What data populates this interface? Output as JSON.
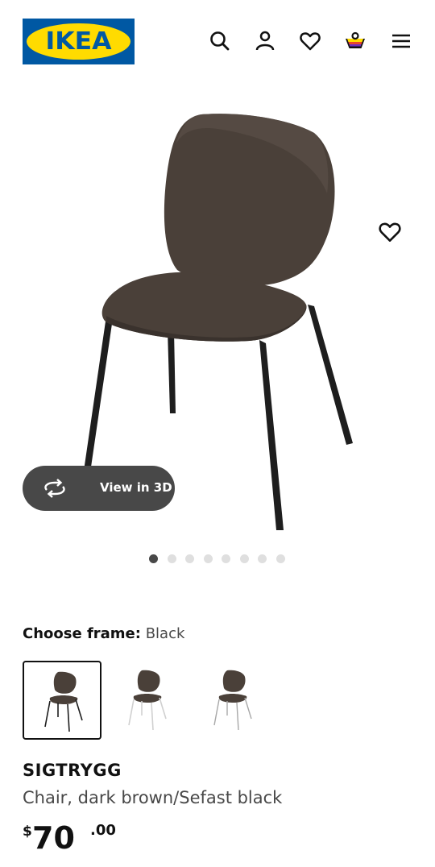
{
  "header": {
    "logo_text": "IKEA",
    "icons": [
      "search-icon",
      "profile-icon",
      "favourites-icon",
      "cart-icon",
      "menu-icon"
    ]
  },
  "gallery": {
    "view_3d_label": "View in 3D",
    "image_count": 8,
    "current_image": 1
  },
  "frame_selector": {
    "label": "Choose frame:",
    "selected_value": "Black",
    "options": [
      "black-frame",
      "white-frame",
      "chrome-frame"
    ]
  },
  "product": {
    "name": "SIGTRYGG",
    "description": "Chair, dark brown/Sefast black",
    "price_currency": "$",
    "price_integer": "70",
    "price_decimal": ".00"
  },
  "colors": {
    "brand_blue": "#0058a3",
    "brand_yellow": "#ffdb00",
    "seat_brown": "#4a4039",
    "button_dark": "#484848"
  }
}
